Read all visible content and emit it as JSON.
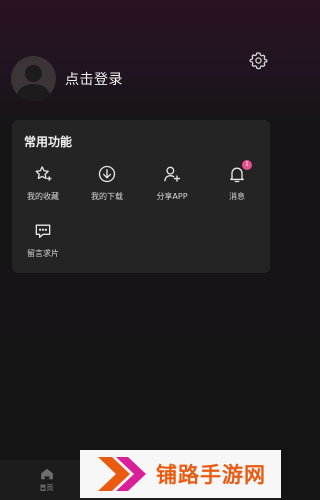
{
  "header": {
    "settings_icon": "gear-icon"
  },
  "profile": {
    "avatar_icon": "user-avatar-icon",
    "login_label": "点击登录"
  },
  "functions": {
    "title": "常用功能",
    "items": [
      {
        "label": "我的收藏",
        "icon": "star-sparkle-icon"
      },
      {
        "label": "我的下载",
        "icon": "download-icon"
      },
      {
        "label": "分享APP",
        "icon": "add-user-icon"
      },
      {
        "label": "消息",
        "icon": "bell-icon",
        "badge": "1"
      },
      {
        "label": "留言求片",
        "icon": "chat-bubble-icon"
      }
    ]
  },
  "tabbar": {
    "home_label": "首页",
    "home_icon": "home-icon"
  },
  "watermark": {
    "text": "铺路手游网",
    "logo_color": "#ea5b12"
  },
  "colors": {
    "accent": "#e8508a",
    "card_bg": "#242424",
    "page_bg": "#141414"
  }
}
